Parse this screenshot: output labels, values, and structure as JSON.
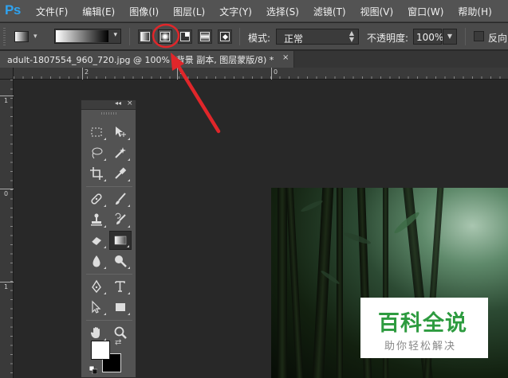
{
  "app": {
    "logo": "Ps",
    "menu": [
      "文件(F)",
      "编辑(E)",
      "图像(I)",
      "图层(L)",
      "文字(Y)",
      "选择(S)",
      "滤镜(T)",
      "视图(V)",
      "窗口(W)",
      "帮助(H)"
    ]
  },
  "options_bar": {
    "tool_preset_icon": "gradient-tool-icon",
    "gradient_preview": "white-to-black",
    "gradient_types": [
      {
        "name": "linear",
        "selected": false
      },
      {
        "name": "radial",
        "selected": true
      },
      {
        "name": "angle",
        "selected": false
      },
      {
        "name": "reflected",
        "selected": false
      },
      {
        "name": "diamond",
        "selected": false
      }
    ],
    "mode_label": "模式:",
    "mode_value": "正常",
    "opacity_label": "不透明度:",
    "opacity_value": "100%",
    "reverse_label": "反向"
  },
  "document": {
    "tab_title": "adult-1807554_960_720.jpg @ 100% (背景 副本, 图层蒙版/8) *",
    "close": "×"
  },
  "rulers": {
    "top": [
      "2",
      "1",
      "0"
    ],
    "left": [
      "1",
      "0",
      "1"
    ]
  },
  "tools_panel": {
    "collapse": "◂◂",
    "close": "×",
    "tools": [
      "rectangular-marquee-icon",
      "move-icon",
      "lasso-icon",
      "magic-wand-icon",
      "crop-icon",
      "eyedropper-icon",
      "spot-healing-icon",
      "brush-icon",
      "clone-stamp-icon",
      "history-brush-icon",
      "eraser-icon",
      "gradient-icon",
      "blur-icon",
      "dodge-icon",
      "pen-icon",
      "type-icon",
      "path-selection-icon",
      "rectangle-shape-icon",
      "hand-icon",
      "zoom-icon"
    ],
    "active_tool": "gradient-icon",
    "foreground_color": "#ffffff",
    "background_color": "#000000"
  },
  "annotation": {
    "color": "#e0262a",
    "target": "radial-gradient-button"
  },
  "watermark": {
    "title": "百科全说",
    "subtitle": "助你轻松解决"
  }
}
